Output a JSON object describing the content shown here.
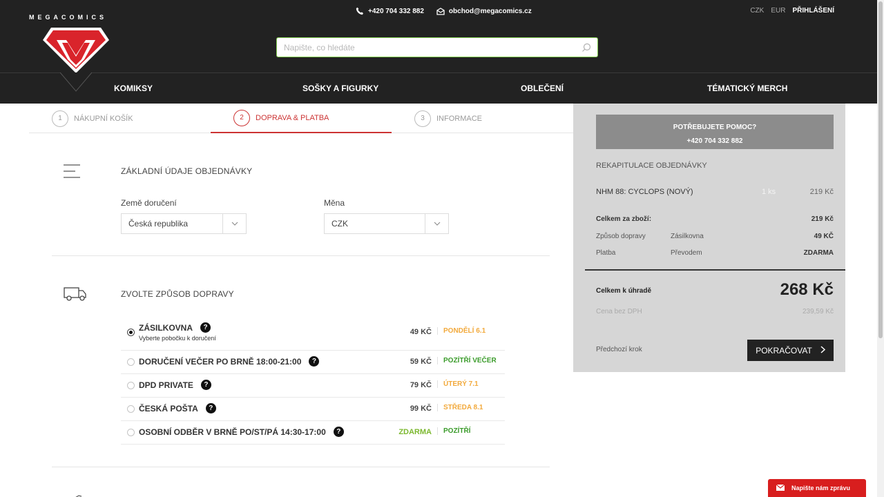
{
  "brand": {
    "name": "MEGACOMICS"
  },
  "contact": {
    "phone": "+420 704 332 882",
    "email": "obchod@megacomics.cz"
  },
  "search": {
    "placeholder": "Napište, co hledáte"
  },
  "topright": {
    "currency_czk": "CZK",
    "currency_eur": "EUR",
    "login": "PŘIHLÁŠENÍ"
  },
  "nav": {
    "items": [
      "KOMIKSY",
      "SOŠKY A FIGURKY",
      "OBLEČENÍ",
      "TÉMATICKÝ MERCH"
    ]
  },
  "steps": [
    {
      "num": "1",
      "label": "NÁKUPNÍ KOŠÍK"
    },
    {
      "num": "2",
      "label": "DOPRAVA & PLATBA"
    },
    {
      "num": "3",
      "label": "INFORMACE"
    }
  ],
  "basic": {
    "title": "ZÁKLADNÍ ÚDAJE OBJEDNÁVKY",
    "country_label": "Země doručení",
    "country_value": "Česká republika",
    "currency_label": "Měna",
    "currency_value": "CZK"
  },
  "shipping": {
    "title": "ZVOLTE ZPŮSOB DOPRAVY",
    "options": [
      {
        "name": "ZÁSILKOVNA",
        "sub": "Vyberte pobočku k doručení",
        "price": "49 KČ",
        "date": "PONDĚLÍ 6.1"
      },
      {
        "name": "DORUČENÍ VEČER PO BRNĚ 18:00-21:00",
        "price": "59 KČ",
        "date": "POZÍTŘÍ VEČER"
      },
      {
        "name": "DPD PRIVATE",
        "price": "79 KČ",
        "date": "ÚTERÝ 7.1"
      },
      {
        "name": "ČESKÁ POŠTA",
        "price": "99 KČ",
        "date": "STŘEDA 8.1"
      },
      {
        "name": "OSOBNÍ ODBĚR V BRNĚ PO/ST/PÁ 14:30-17:00",
        "price": "ZDARMA",
        "date": "POZÍTŘÍ"
      }
    ],
    "help_glyph": "?"
  },
  "colors": {
    "date_orange": "#f2a93b",
    "date_green": "#3a9b2a",
    "accent_red": "#cc3333",
    "header_bg": "#222222"
  },
  "summary": {
    "help_title": "POTŘEBUJETE POMOC?",
    "help_phone": "+420 704 332 882",
    "title": "REKAPITULACE OBJEDNÁVKY",
    "item_name": "NHM 88: CYCLOPS (NOVÝ)",
    "item_qty": "1  ks",
    "item_price": "219 Kč",
    "goods_label": "Celkem za zboží:",
    "goods_value": "219 Kč",
    "shipping_label": "Způsob dopravy",
    "shipping_method": "Zásilkovna",
    "shipping_value": "49 KČ",
    "payment_label": "Platba",
    "payment_method": "Převodem",
    "payment_value": "ZDARMA",
    "total_label": "Celkem k úhradě",
    "total_value": "268 Kč",
    "net_label": "Cena bez DPH",
    "net_value": "239,59 Kč",
    "prev_step": "Předchozí krok",
    "continue": "POKRAČOVAT"
  },
  "chat": {
    "label": "Napište nám zprávu"
  }
}
